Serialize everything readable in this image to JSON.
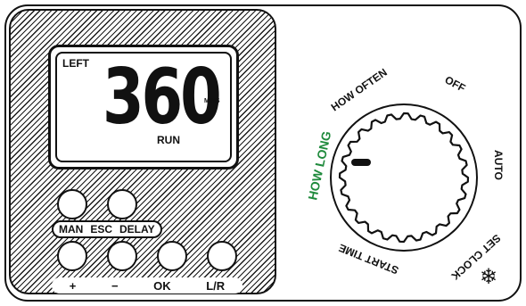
{
  "display": {
    "left_label": "LEFT",
    "value": "360",
    "unit": "MINS",
    "mode": "RUN"
  },
  "buttons": {
    "top_row": [
      {
        "label": "MAN"
      },
      {
        "label": "ESC"
      },
      {
        "label": "DELAY"
      }
    ],
    "bottom_row": [
      {
        "label": "+"
      },
      {
        "label": "−"
      },
      {
        "label": "OK"
      },
      {
        "label": "L/R"
      }
    ]
  },
  "dial": {
    "labels": {
      "how_long": "HOW LONG",
      "how_often": "HOW OFTEN",
      "off": "OFF",
      "auto": "AUTO",
      "set_clock": "SET CLOCK",
      "start_time": "START TIME"
    },
    "active_color": "#1f8a3c",
    "text_color": "#111111"
  },
  "icons": {
    "frost": "snowflake-icon"
  }
}
